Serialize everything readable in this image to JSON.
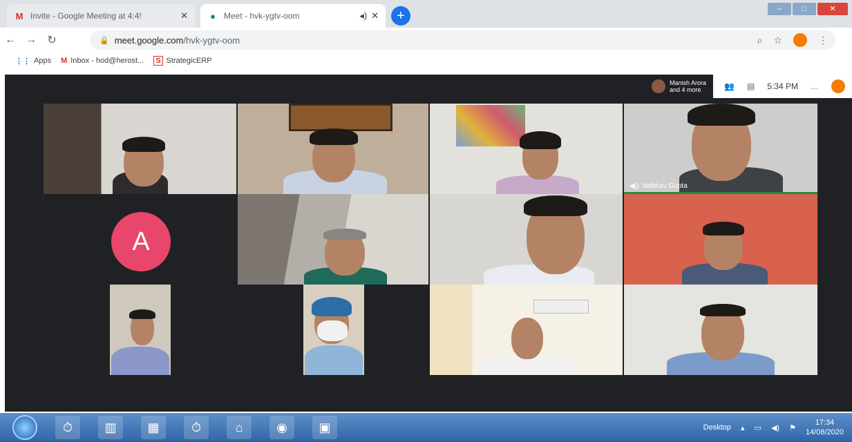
{
  "browser": {
    "tabs": [
      {
        "label": "Invite - Google Meeting at 4:4!",
        "icon": "gmail-icon",
        "active": false
      },
      {
        "label": "Meet - hvk-ygtv-oom",
        "icon": "meet-icon",
        "active": true
      }
    ],
    "new_tab_symbol": "+",
    "url_domain": "meet.google.com",
    "url_path": "/hvk-ygtv-oom",
    "bookmarks": [
      {
        "label": "Apps",
        "icon": "apps-icon"
      },
      {
        "label": "Inbox - hod@herost...",
        "icon": "gmail-icon"
      },
      {
        "label": "StrategicERP",
        "icon": "erp-icon"
      }
    ]
  },
  "meet": {
    "presenter_line1": "Manish Arora",
    "presenter_line2": "and 4 more",
    "time": "5:34 PM",
    "speaker_name": "Vaibhav Gupta",
    "avatar_letter": "A"
  },
  "taskbar": {
    "tray_label": "Desktop",
    "clock_time": "17:34",
    "clock_date": "14/08/2020"
  },
  "colors": {
    "meet_bg": "#202124",
    "avatar_pink": "#e8466a",
    "taskbar_blue": "#2f64a8"
  }
}
